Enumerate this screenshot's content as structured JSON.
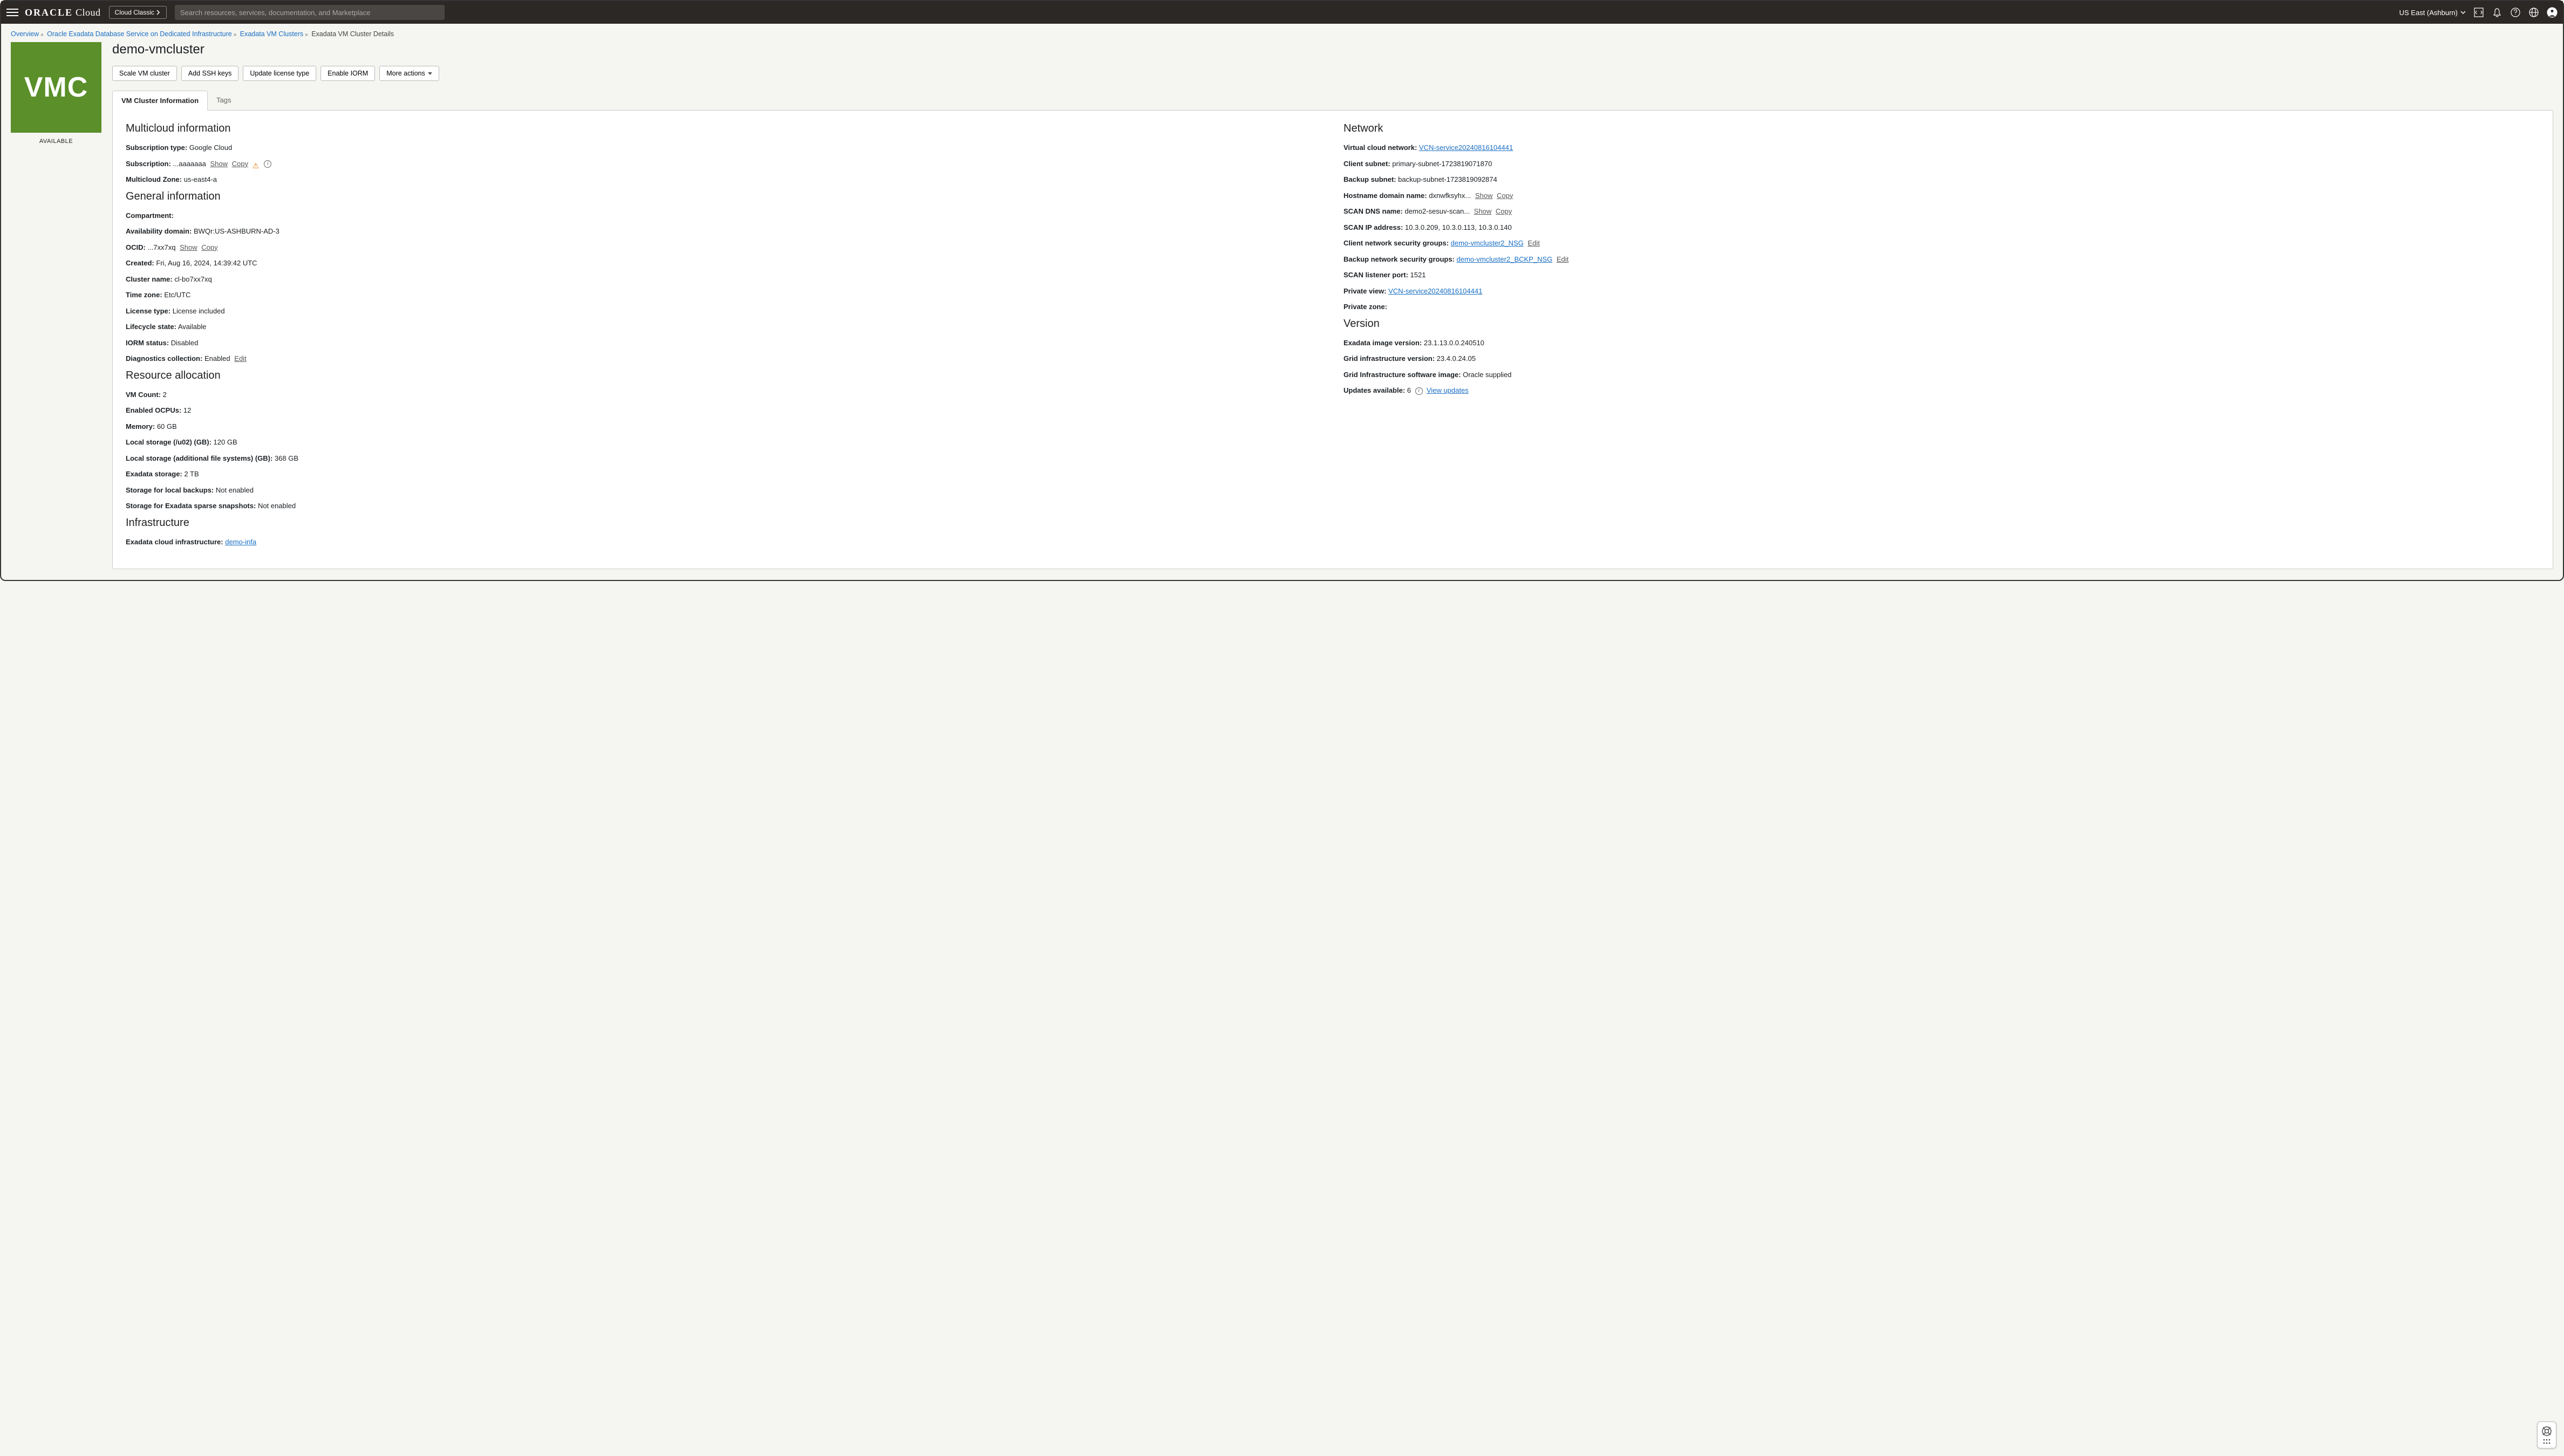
{
  "header": {
    "brand_strong": "ORACLE",
    "brand_light": "Cloud",
    "cloud_classic": "Cloud Classic",
    "search_placeholder": "Search resources, services, documentation, and Marketplace",
    "region": "US East (Ashburn)"
  },
  "breadcrumbs": {
    "items": [
      {
        "label": "Overview",
        "link": true
      },
      {
        "label": "Oracle Exadata Database Service on Dedicated Infrastructure",
        "link": true
      },
      {
        "label": "Exadata VM Clusters",
        "link": true
      },
      {
        "label": "Exadata VM Cluster Details",
        "link": false
      }
    ]
  },
  "resource": {
    "tile_abbrev": "VMC",
    "status": "AVAILABLE",
    "title": "demo-vmcluster"
  },
  "buttons": {
    "scale": "Scale VM cluster",
    "ssh": "Add SSH keys",
    "license": "Update license type",
    "iorm": "Enable IORM",
    "more": "More actions"
  },
  "tabs": {
    "info": "VM Cluster Information",
    "tags": "Tags"
  },
  "sections": {
    "multicloud_h": "Multicloud information",
    "multicloud": {
      "sub_type_l": "Subscription type:",
      "sub_type_v": "Google Cloud",
      "sub_l": "Subscription:",
      "sub_v": "...aaaaaaa",
      "show": "Show",
      "copy": "Copy",
      "zone_l": "Multicloud Zone:",
      "zone_v": "us-east4-a"
    },
    "general_h": "General information",
    "general": {
      "comp_l": "Compartment:",
      "comp_v": "",
      "ad_l": "Availability domain:",
      "ad_v": "BWQr:US-ASHBURN-AD-3",
      "ocid_l": "OCID:",
      "ocid_v": "...7xx7xq",
      "show": "Show",
      "copy": "Copy",
      "created_l": "Created:",
      "created_v": "Fri, Aug 16, 2024, 14:39:42 UTC",
      "cname_l": "Cluster name:",
      "cname_v": "cl-bo7xx7xq",
      "tz_l": "Time zone:",
      "tz_v": "Etc/UTC",
      "lic_l": "License type:",
      "lic_v": "License included",
      "life_l": "Lifecycle state:",
      "life_v": "Available",
      "iorm_l": "IORM status:",
      "iorm_v": "Disabled",
      "diag_l": "Diagnostics collection:",
      "diag_v": "Enabled",
      "edit": "Edit"
    },
    "resource_h": "Resource allocation",
    "resource": {
      "vmc_l": "VM Count:",
      "vmc_v": "2",
      "ocpu_l": "Enabled OCPUs:",
      "ocpu_v": "12",
      "mem_l": "Memory:",
      "mem_v": "60 GB",
      "ls_l": "Local storage (/u02) (GB):",
      "ls_v": "120 GB",
      "lsa_l": "Local storage (additional file systems) (GB):",
      "lsa_v": "368 GB",
      "exs_l": "Exadata storage:",
      "exs_v": "2 TB",
      "slb_l": "Storage for local backups:",
      "slb_v": "Not enabled",
      "sess_l": "Storage for Exadata sparse snapshots:",
      "sess_v": "Not enabled"
    },
    "infra_h": "Infrastructure",
    "infra": {
      "eci_l": "Exadata cloud infrastructure:",
      "eci_link": "demo-infa"
    },
    "network_h": "Network",
    "network": {
      "vcn_l": "Virtual cloud network:",
      "vcn_link": "VCN-service20240816104441",
      "cs_l": "Client subnet:",
      "cs_v": "primary-subnet-1723819071870",
      "bs_l": "Backup subnet:",
      "bs_v": "backup-subnet-1723819092874",
      "hdn_l": "Hostname domain name:",
      "hdn_v": "dxnwfksyhx...",
      "show": "Show",
      "copy": "Copy",
      "sdn_l": "SCAN DNS name:",
      "sdn_v": "demo2-sesuv-scan...",
      "sip_l": "SCAN IP address:",
      "sip_v": "10.3.0.209, 10.3.0.113, 10.3.0.140",
      "cnsg_l": "Client network security groups:",
      "cnsg_link": "demo-vmcluster2_NSG",
      "edit": "Edit",
      "bnsg_l": "Backup network security groups:",
      "bnsg_link": "demo-vmcluster2_BCKP_NSG",
      "slp_l": "SCAN listener port:",
      "slp_v": "1521",
      "pv_l": "Private view:",
      "pv_link": "VCN-service20240816104441",
      "pz_l": "Private zone:",
      "pz_v": ""
    },
    "version_h": "Version",
    "version": {
      "eiv_l": "Exadata image version:",
      "eiv_v": "23.1.13.0.0.240510",
      "giv_l": "Grid infrastructure version:",
      "giv_v": "23.4.0.24.05",
      "gis_l": "Grid Infrastructure software image:",
      "gis_v": "Oracle supplied",
      "upd_l": "Updates available:",
      "upd_v": "6",
      "upd_link": "View updates"
    }
  }
}
